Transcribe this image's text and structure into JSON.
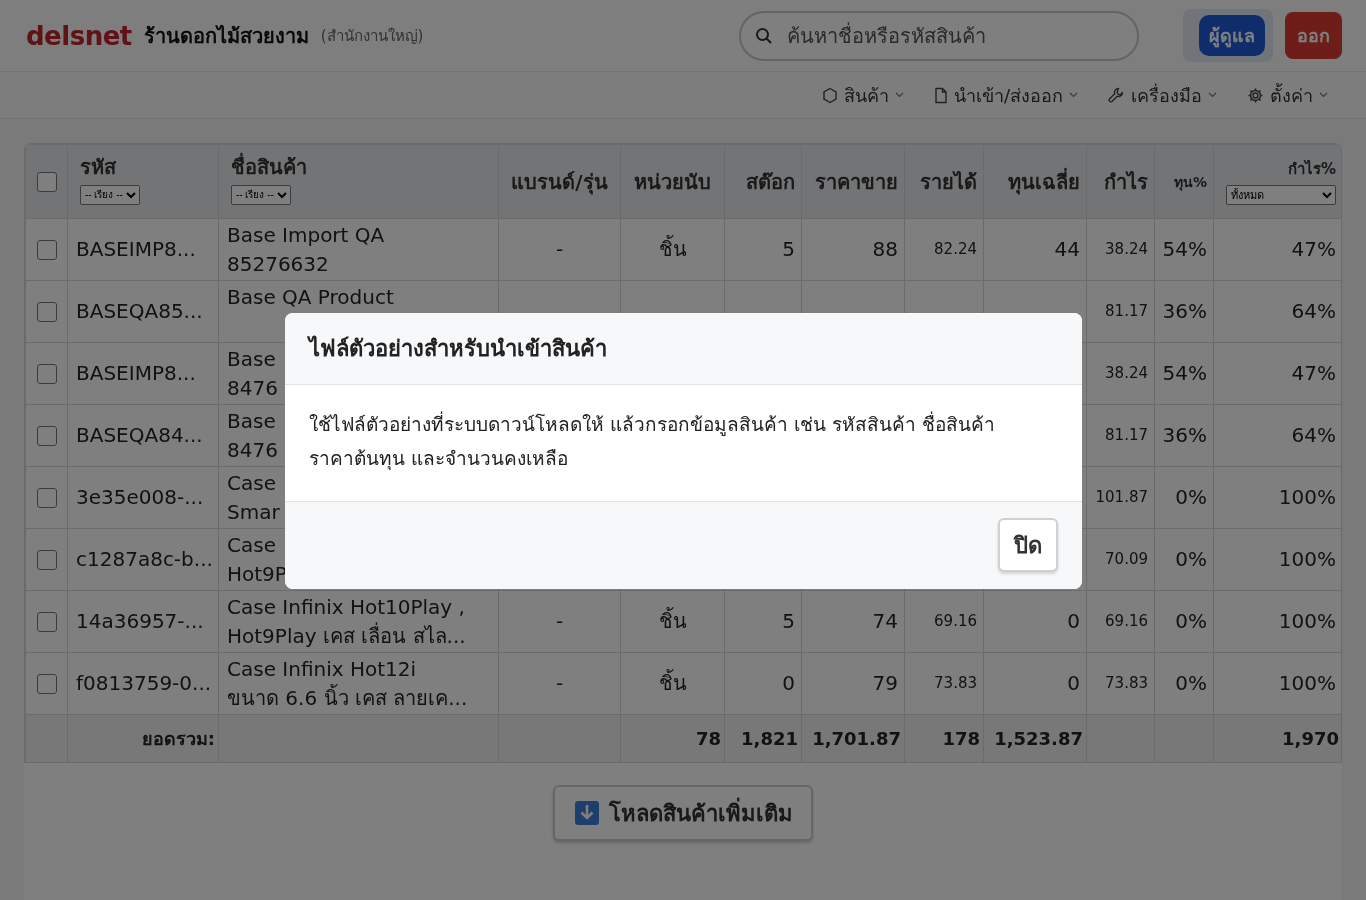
{
  "header": {
    "logo": "delsnet",
    "shop_name": "ร้านดอกไม้สวยงาม",
    "branch": "(สำนักงานใหญ่)",
    "search": {
      "placeholder": "ค้นหาชื่อหรือรหัสสินค้า"
    },
    "buttons": [
      {
        "label": "ผู้ดูแล",
        "kind": "admin"
      },
      {
        "label": "ออก",
        "kind": "logout"
      }
    ]
  },
  "nav": [
    {
      "label": "สินค้า",
      "kind": "box"
    },
    {
      "label": "นำเข้า/ส่งออก",
      "kind": "file"
    },
    {
      "label": "เครื่องมือ",
      "kind": "wrench"
    },
    {
      "label": "ตั้งค่า",
      "kind": "gear"
    }
  ],
  "table": {
    "select_all": {
      "checked": false
    },
    "columns": [
      {
        "label": "รหัส",
        "sort": "-- เรียง --"
      },
      {
        "label": "ชื่อสินค้า",
        "sort": "-- เรียง --"
      },
      {
        "label": "แบรนด์/รุ่น"
      },
      {
        "label": "หน่วยนับ"
      },
      {
        "label": "สต๊อก"
      },
      {
        "label": "ราคาขาย"
      },
      {
        "label": "รายได้"
      },
      {
        "label": "ทุนเฉลี่ย"
      },
      {
        "label": "กำไร"
      },
      {
        "label": "ทุน%"
      },
      {
        "label": "กำไร%",
        "filter": "ทั้งหมด"
      }
    ],
    "rows": [
      {
        "checked": false,
        "cells": [
          "BASEIMP8...",
          "Base Import QA\n85276632",
          "-",
          "ชิ้น",
          "5",
          "88",
          "82.24",
          "44",
          "38.24",
          "54%",
          "47%"
        ]
      },
      {
        "checked": false,
        "cells": [
          "BASEQA85...",
          "Base QA Product",
          "",
          "",
          "",
          "",
          "",
          "",
          "81.17",
          "36%",
          "64%"
        ]
      },
      {
        "checked": false,
        "cells": [
          "BASEIMP8...",
          "Base\n8476",
          "",
          "",
          "",
          "",
          "",
          "",
          "38.24",
          "54%",
          "47%"
        ]
      },
      {
        "checked": false,
        "cells": [
          "BASEQA84...",
          "Base\n8476",
          "",
          "",
          "",
          "",
          "",
          "",
          "81.17",
          "36%",
          "64%"
        ]
      },
      {
        "checked": false,
        "cells": [
          "3e35e008-...",
          "Case\nSmar",
          "",
          "",
          "",
          "",
          "",
          "",
          "101.87",
          "0%",
          "100%"
        ]
      },
      {
        "checked": false,
        "cells": [
          "c1287a8c-b...",
          "Case\nHot9P",
          "",
          "",
          "",
          "",
          "",
          "",
          "70.09",
          "0%",
          "100%"
        ]
      },
      {
        "checked": false,
        "cells": [
          "14a36957-...",
          "Case Infinix Hot10Play ,\nHot9Play เคส เลื่อน สไล...",
          "-",
          "ชิ้น",
          "5",
          "74",
          "69.16",
          "0",
          "69.16",
          "0%",
          "100%"
        ]
      },
      {
        "checked": false,
        "cells": [
          "f0813759-0...",
          "Case Infinix Hot12i\nขนาด 6.6 นิ้ว เคส ลายเค...",
          "-",
          "ชิ้น",
          "0",
          "79",
          "73.83",
          "0",
          "73.83",
          "0%",
          "100%"
        ]
      }
    ],
    "footer": {
      "cells": [
        "ยอดรวม:",
        "",
        "",
        "78",
        "1,821",
        "1,701.87",
        "178",
        "1,523.87",
        "",
        "",
        "1,970"
      ]
    }
  },
  "load_more": {
    "label": "โหลดสินค้าเพิ่มเติม"
  },
  "modal": {
    "title": "ไฟล์ตัวอย่างสำหรับนำเข้าสินค้า",
    "body": "ใช้ไฟล์ตัวอย่างที่ระบบดาวน์โหลดให้ แล้วกรอกข้อมูลสินค้า เช่น รหัสสินค้า ชื่อสินค้า ราคาต้นทุน และจำนวนคงเหลือ",
    "close": "ปิด"
  }
}
